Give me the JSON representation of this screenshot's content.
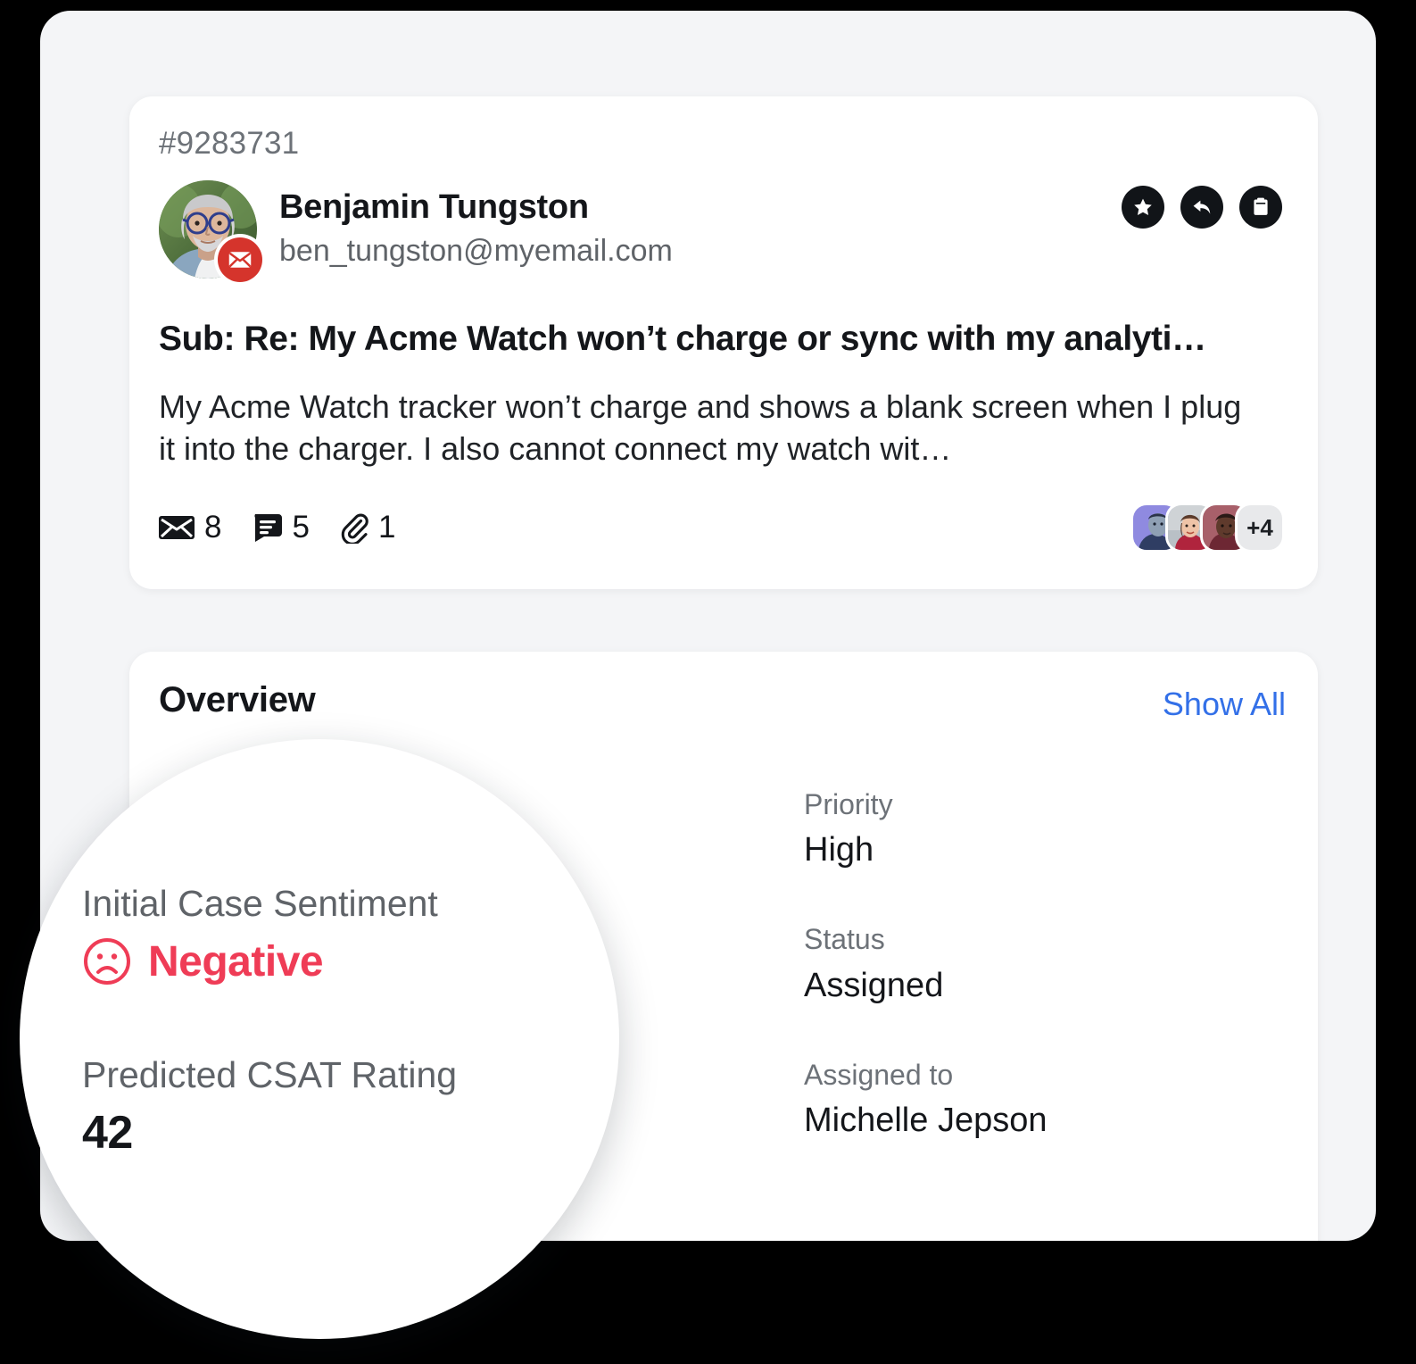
{
  "ticket": {
    "id": "#9283731",
    "requester": {
      "name": "Benjamin Tungston",
      "email": "ben_tungston@myemail.com",
      "channel_icon": "email-badge-icon"
    },
    "actions": [
      {
        "name": "star-icon",
        "label": "Star"
      },
      {
        "name": "reply-icon",
        "label": "Reply"
      },
      {
        "name": "clipboard-icon",
        "label": "Copy"
      }
    ],
    "subject": "Sub: Re: My Acme Watch won’t charge or sync with my analyti…",
    "body_preview": "My Acme Watch tracker won’t charge and shows a blank screen when I plug it into the charger. I also cannot connect my watch wit…",
    "meta": [
      {
        "icon": "envelope-icon",
        "count": "8"
      },
      {
        "icon": "note-icon",
        "count": "5"
      },
      {
        "icon": "paperclip-icon",
        "count": "1"
      }
    ],
    "participants": {
      "avatars": [
        "participant-1",
        "participant-2",
        "participant-3"
      ],
      "overflow": "+4"
    }
  },
  "overview": {
    "title": "Overview",
    "show_all_label": "Show All",
    "show_all_color": "#3370e8",
    "fields_left": [
      {
        "label": "Initial Case Sentiment",
        "value": "Negative"
      },
      {
        "label": "Predicted CSAT Rating",
        "value": "42"
      }
    ],
    "fields_right": [
      {
        "label": "Priority",
        "value": "High"
      },
      {
        "label": "Status",
        "value": "Assigned"
      },
      {
        "label": "Assigned to",
        "value": "Michelle Jepson"
      }
    ]
  },
  "magnifier": {
    "sentiment_label": "Initial Case Sentiment",
    "sentiment_value": "Negative",
    "sentiment_color": "#ef3c56",
    "sentiment_icon": "frowning-face-icon",
    "csat_label": "Predicted CSAT Rating",
    "csat_value": "42"
  }
}
